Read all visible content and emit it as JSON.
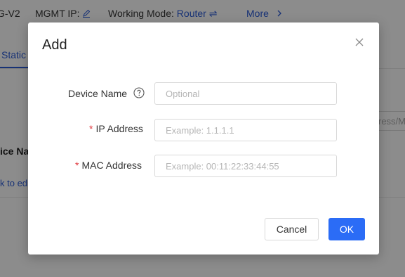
{
  "topbar": {
    "model_suffix": "G-V2",
    "mgmt_ip_label": "MGMT IP:",
    "working_mode_label": "Working Mode:",
    "working_mode_value": "Router",
    "working_mode_toggle_glyph": "⇌",
    "more_label": "More"
  },
  "background": {
    "tab_static": "Static",
    "search_placeholder": "ress/M",
    "column_header": "ice Na",
    "row_link": "k to edi"
  },
  "dialog": {
    "title": "Add",
    "fields": {
      "device_name": {
        "label": "Device Name",
        "placeholder": "Optional",
        "value": ""
      },
      "ip_address": {
        "label": "IP Address",
        "required_mark": "*",
        "placeholder": "Example: 1.1.1.1",
        "value": ""
      },
      "mac_address": {
        "label": "MAC Address",
        "required_mark": "*",
        "placeholder": "Example: 00:11:22:33:44:55",
        "value": ""
      }
    },
    "buttons": {
      "cancel": "Cancel",
      "ok": "OK"
    }
  },
  "colors": {
    "accent": "#2b6cf6",
    "link": "#2b5bd7",
    "required": "#e0383e",
    "overlay": "rgba(0,0,0,0.45)"
  },
  "icons": [
    "edit-icon",
    "swap-icon",
    "chevron-right-icon",
    "close-icon",
    "help-circle-icon"
  ]
}
